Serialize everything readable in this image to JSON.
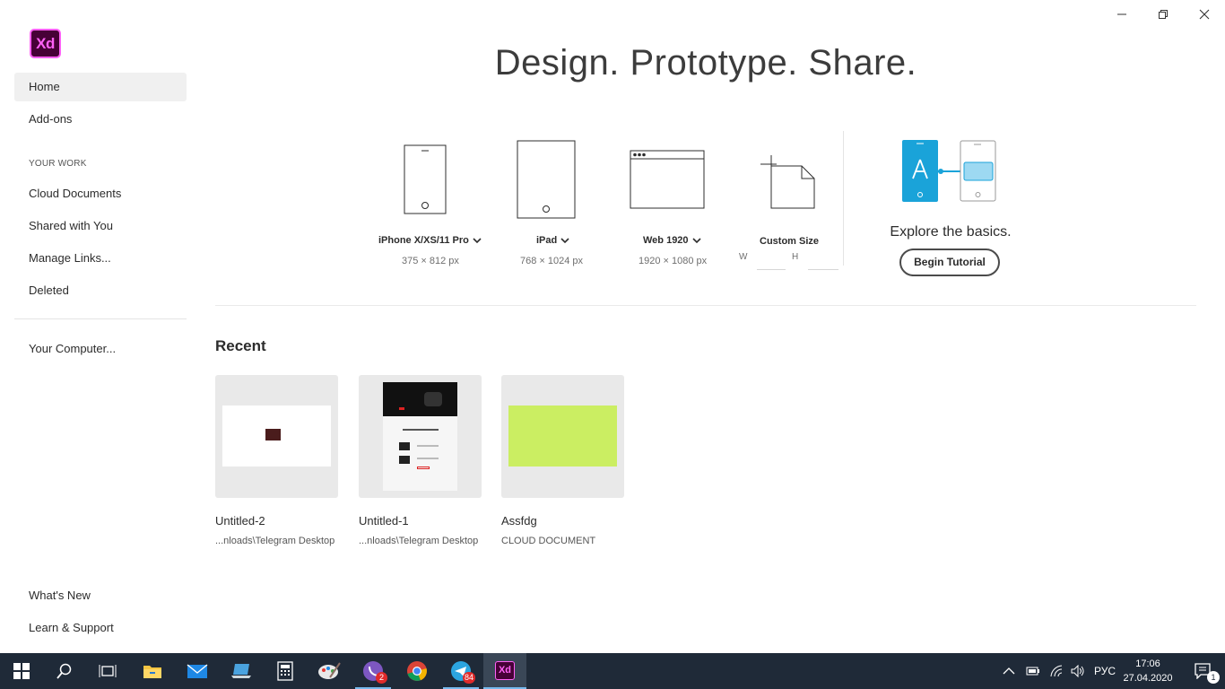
{
  "window": {
    "minimize_icon": "minimize-icon",
    "restore_icon": "restore-icon",
    "close_icon": "close-icon"
  },
  "app": {
    "logo_text": "Xd"
  },
  "sidebar": {
    "home": "Home",
    "addons": "Add-ons",
    "section_your_work": "YOUR WORK",
    "cloud_documents": "Cloud Documents",
    "shared_with_you": "Shared with You",
    "manage_links": "Manage Links...",
    "deleted": "Deleted",
    "your_computer": "Your Computer...",
    "whats_new": "What's New",
    "learn_support": "Learn & Support"
  },
  "headline": "Design. Prototype. Share.",
  "presets": [
    {
      "label": "iPhone X/XS/11 Pro",
      "dims": "375 × 812 px"
    },
    {
      "label": "iPad",
      "dims": "768 × 1024 px"
    },
    {
      "label": "Web 1920",
      "dims": "1920 × 1080 px"
    },
    {
      "label": "Custom Size",
      "w_label": "W",
      "h_label": "H"
    }
  ],
  "tutorial": {
    "text": "Explore the basics.",
    "button": "Begin Tutorial"
  },
  "recent": {
    "title": "Recent",
    "items": [
      {
        "name": "Untitled-2",
        "location": "...nloads\\Telegram Desktop"
      },
      {
        "name": "Untitled-1",
        "location": "...nloads\\Telegram Desktop"
      },
      {
        "name": "Assfdg",
        "location": "CLOUD DOCUMENT"
      }
    ]
  },
  "colors": {
    "accent_blue": "#1aa3d9",
    "green_card": "#cbee62",
    "xd_purple": "#470137",
    "xd_pink": "#ff61f6"
  },
  "taskbar": {
    "viber_badge": "2",
    "telegram_badge": "84",
    "xd_label": "Xd",
    "language": "РУС",
    "time": "17:06",
    "date": "27.04.2020",
    "notification_count": "1"
  }
}
